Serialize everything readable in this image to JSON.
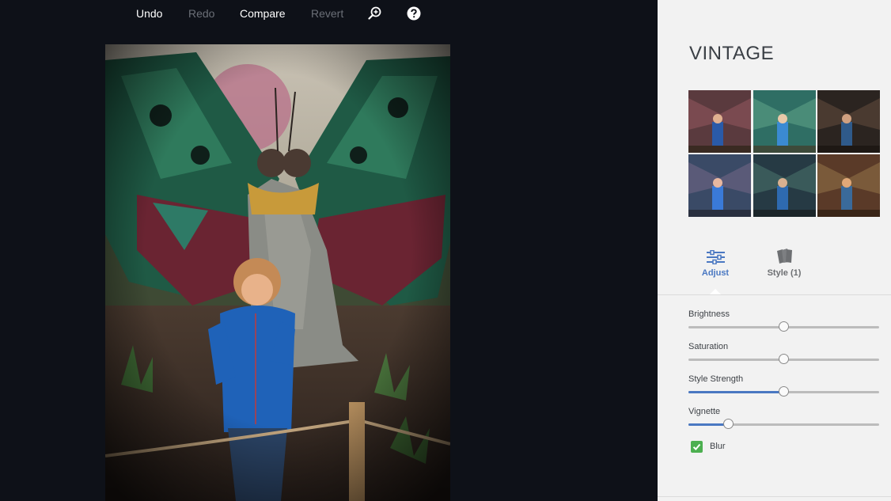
{
  "toolbar": {
    "undo": "Undo",
    "redo": "Redo",
    "compare": "Compare",
    "revert": "Revert",
    "zoom_icon": "zoom-icon",
    "help_icon": "help-icon"
  },
  "panel": {
    "title": "VINTAGE",
    "tabs": [
      {
        "label": "Adjust",
        "icon": "sliders-icon",
        "active": true
      },
      {
        "label": "Style (1)",
        "icon": "cards-icon",
        "active": false
      }
    ],
    "sliders": [
      {
        "label": "Brightness",
        "value": 0.5
      },
      {
        "label": "Saturation",
        "value": 0.5
      },
      {
        "label": "Style Strength",
        "value": 0.5
      },
      {
        "label": "Vignette",
        "value": 0.21
      }
    ],
    "blur": {
      "label": "Blur",
      "checked": true
    }
  },
  "colors": {
    "accent": "#4a78c2",
    "check": "#4caf50",
    "background": "#0e1118"
  }
}
